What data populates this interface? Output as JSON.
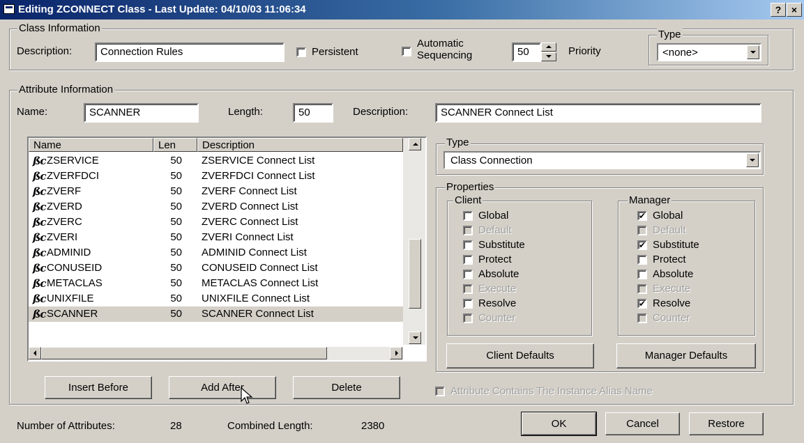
{
  "window": {
    "title": "Editing ZCONNECT Class   - Last Update: 04/10/03 11:06:34",
    "help_label": "?",
    "close_label": "×"
  },
  "class_info": {
    "legend": "Class Information",
    "description_label": "Description:",
    "description_value": "Connection Rules",
    "persistent_label": "Persistent",
    "automatic_label_1": "Automatic",
    "automatic_label_2": "Sequencing",
    "priority_value": "50",
    "priority_label": "Priority",
    "type_legend": "Type",
    "type_value": "<none>"
  },
  "attr_info": {
    "legend": "Attribute Information",
    "name_label": "Name:",
    "name_value": "SCANNER",
    "length_label": "Length:",
    "length_value": "50",
    "description_label": "Description:",
    "description_value": "SCANNER Connect List"
  },
  "list": {
    "columns": [
      "Name",
      "Len",
      "Description"
    ],
    "icon_glyph": "ßc",
    "rows": [
      {
        "name": "ZSERVICE",
        "len": "50",
        "desc": "ZSERVICE Connect List"
      },
      {
        "name": "ZVERFDCI",
        "len": "50",
        "desc": "ZVERFDCI Connect List"
      },
      {
        "name": "ZVERF",
        "len": "50",
        "desc": "ZVERF Connect List"
      },
      {
        "name": "ZVERD",
        "len": "50",
        "desc": "ZVERD Connect List"
      },
      {
        "name": "ZVERC",
        "len": "50",
        "desc": "ZVERC Connect List"
      },
      {
        "name": "ZVERI",
        "len": "50",
        "desc": "ZVERI Connect List"
      },
      {
        "name": "ADMINID",
        "len": "50",
        "desc": "ADMINID Connect List"
      },
      {
        "name": "CONUSEID",
        "len": "50",
        "desc": "CONUSEID Connect List"
      },
      {
        "name": "METACLAS",
        "len": "50",
        "desc": "METACLAS Connect List"
      },
      {
        "name": "UNIXFILE",
        "len": "50",
        "desc": "UNIXFILE Connect List"
      },
      {
        "name": "SCANNER",
        "len": "50",
        "desc": "SCANNER Connect List",
        "selected": true
      }
    ]
  },
  "buttons": {
    "insert_before": "Insert Before",
    "add_after": "Add After",
    "delete": "Delete",
    "client_defaults": "Client Defaults",
    "manager_defaults": "Manager Defaults",
    "ok": "OK",
    "cancel": "Cancel",
    "restore": "Restore"
  },
  "type_group": {
    "legend": "Type",
    "value": "Class Connection"
  },
  "properties": {
    "legend": "Properties",
    "client": {
      "legend": "Client",
      "items": [
        {
          "label": "Global",
          "checked": false,
          "disabled": false
        },
        {
          "label": "Default",
          "checked": false,
          "disabled": true
        },
        {
          "label": "Substitute",
          "checked": false,
          "disabled": false
        },
        {
          "label": "Protect",
          "checked": false,
          "disabled": false
        },
        {
          "label": "Absolute",
          "checked": false,
          "disabled": false
        },
        {
          "label": "Execute",
          "checked": false,
          "disabled": true
        },
        {
          "label": "Resolve",
          "checked": false,
          "disabled": false
        },
        {
          "label": "Counter",
          "checked": false,
          "disabled": true
        }
      ]
    },
    "manager": {
      "legend": "Manager",
      "items": [
        {
          "label": "Global",
          "checked": true,
          "disabled": false
        },
        {
          "label": "Default",
          "checked": false,
          "disabled": true
        },
        {
          "label": "Substitute",
          "checked": true,
          "disabled": false
        },
        {
          "label": "Protect",
          "checked": false,
          "disabled": false
        },
        {
          "label": "Absolute",
          "checked": false,
          "disabled": false
        },
        {
          "label": "Execute",
          "checked": false,
          "disabled": true
        },
        {
          "label": "Resolve",
          "checked": true,
          "disabled": false
        },
        {
          "label": "Counter",
          "checked": false,
          "disabled": true
        }
      ]
    }
  },
  "alias_checkbox_label": "Attribute Contains The Instance Alias Name",
  "footer": {
    "num_attr_label": "Number of Attributes:",
    "num_attr_value": "28",
    "combined_label": "Combined Length:",
    "combined_value": "2380"
  },
  "check_glyph": "✔"
}
